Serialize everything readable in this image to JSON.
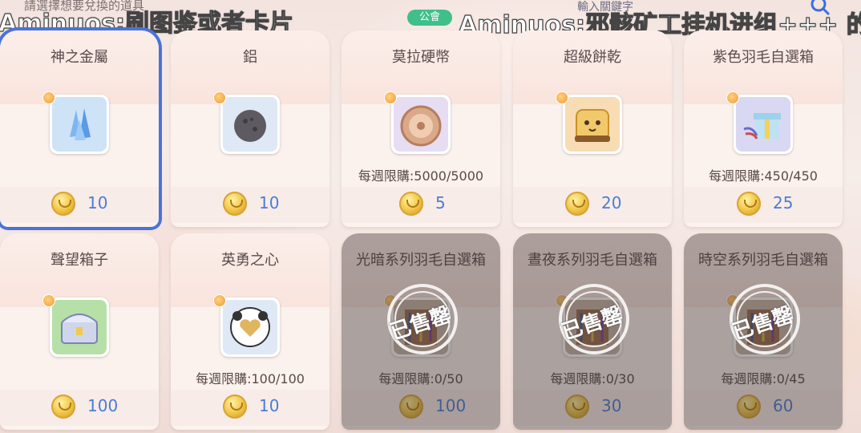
{
  "header": {
    "hint": "請選擇想要兌換的道具",
    "overlay_left": "Aminuos:刷图鉴或者卡片",
    "overlay_right": "Aminuos:邪骸矿工挂机进组+++ 的",
    "guild_badge": "公會",
    "search_placeholder": "輸入關鍵字"
  },
  "colors": {
    "selected_border": "#4a73d9",
    "price_text": "#4a7dd4",
    "guild_badge": "#3fbf8a"
  },
  "items": [
    {
      "name": "神之金屬",
      "price": "10",
      "limit": "",
      "sold_out": false,
      "icon": "crystal-icon",
      "selected": true
    },
    {
      "name": "鋁",
      "price": "10",
      "limit": "",
      "sold_out": false,
      "icon": "ore-icon",
      "selected": false
    },
    {
      "name": "莫拉硬幣",
      "price": "5",
      "limit": "每週限購:5000/5000",
      "sold_out": false,
      "icon": "coin-medal-icon",
      "selected": false
    },
    {
      "name": "超級餅乾",
      "price": "20",
      "limit": "",
      "sold_out": false,
      "icon": "cookie-icon",
      "selected": false
    },
    {
      "name": "紫色羽毛自選箱",
      "price": "25",
      "limit": "每週限購:450/450",
      "sold_out": false,
      "icon": "gift-box-icon",
      "selected": false
    },
    {
      "name": "聲望箱子",
      "price": "100",
      "limit": "",
      "sold_out": false,
      "icon": "treasure-chest-icon",
      "selected": false
    },
    {
      "name": "英勇之心",
      "price": "10",
      "limit": "每週限購:100/100",
      "sold_out": false,
      "icon": "heart-icon",
      "selected": false
    },
    {
      "name": "光暗系列羽毛自選箱",
      "price": "100",
      "limit": "每週限購:0/50",
      "sold_out": true,
      "icon": "feather-box-icon",
      "selected": false
    },
    {
      "name": "晝夜系列羽毛自選箱",
      "price": "30",
      "limit": "每週限購:0/30",
      "sold_out": true,
      "icon": "feather-box-icon",
      "selected": false
    },
    {
      "name": "時空系列羽毛自選箱",
      "price": "60",
      "limit": "每週限購:0/45",
      "sold_out": true,
      "icon": "feather-box-icon",
      "selected": false
    }
  ],
  "sold_out_label": "已售罄"
}
